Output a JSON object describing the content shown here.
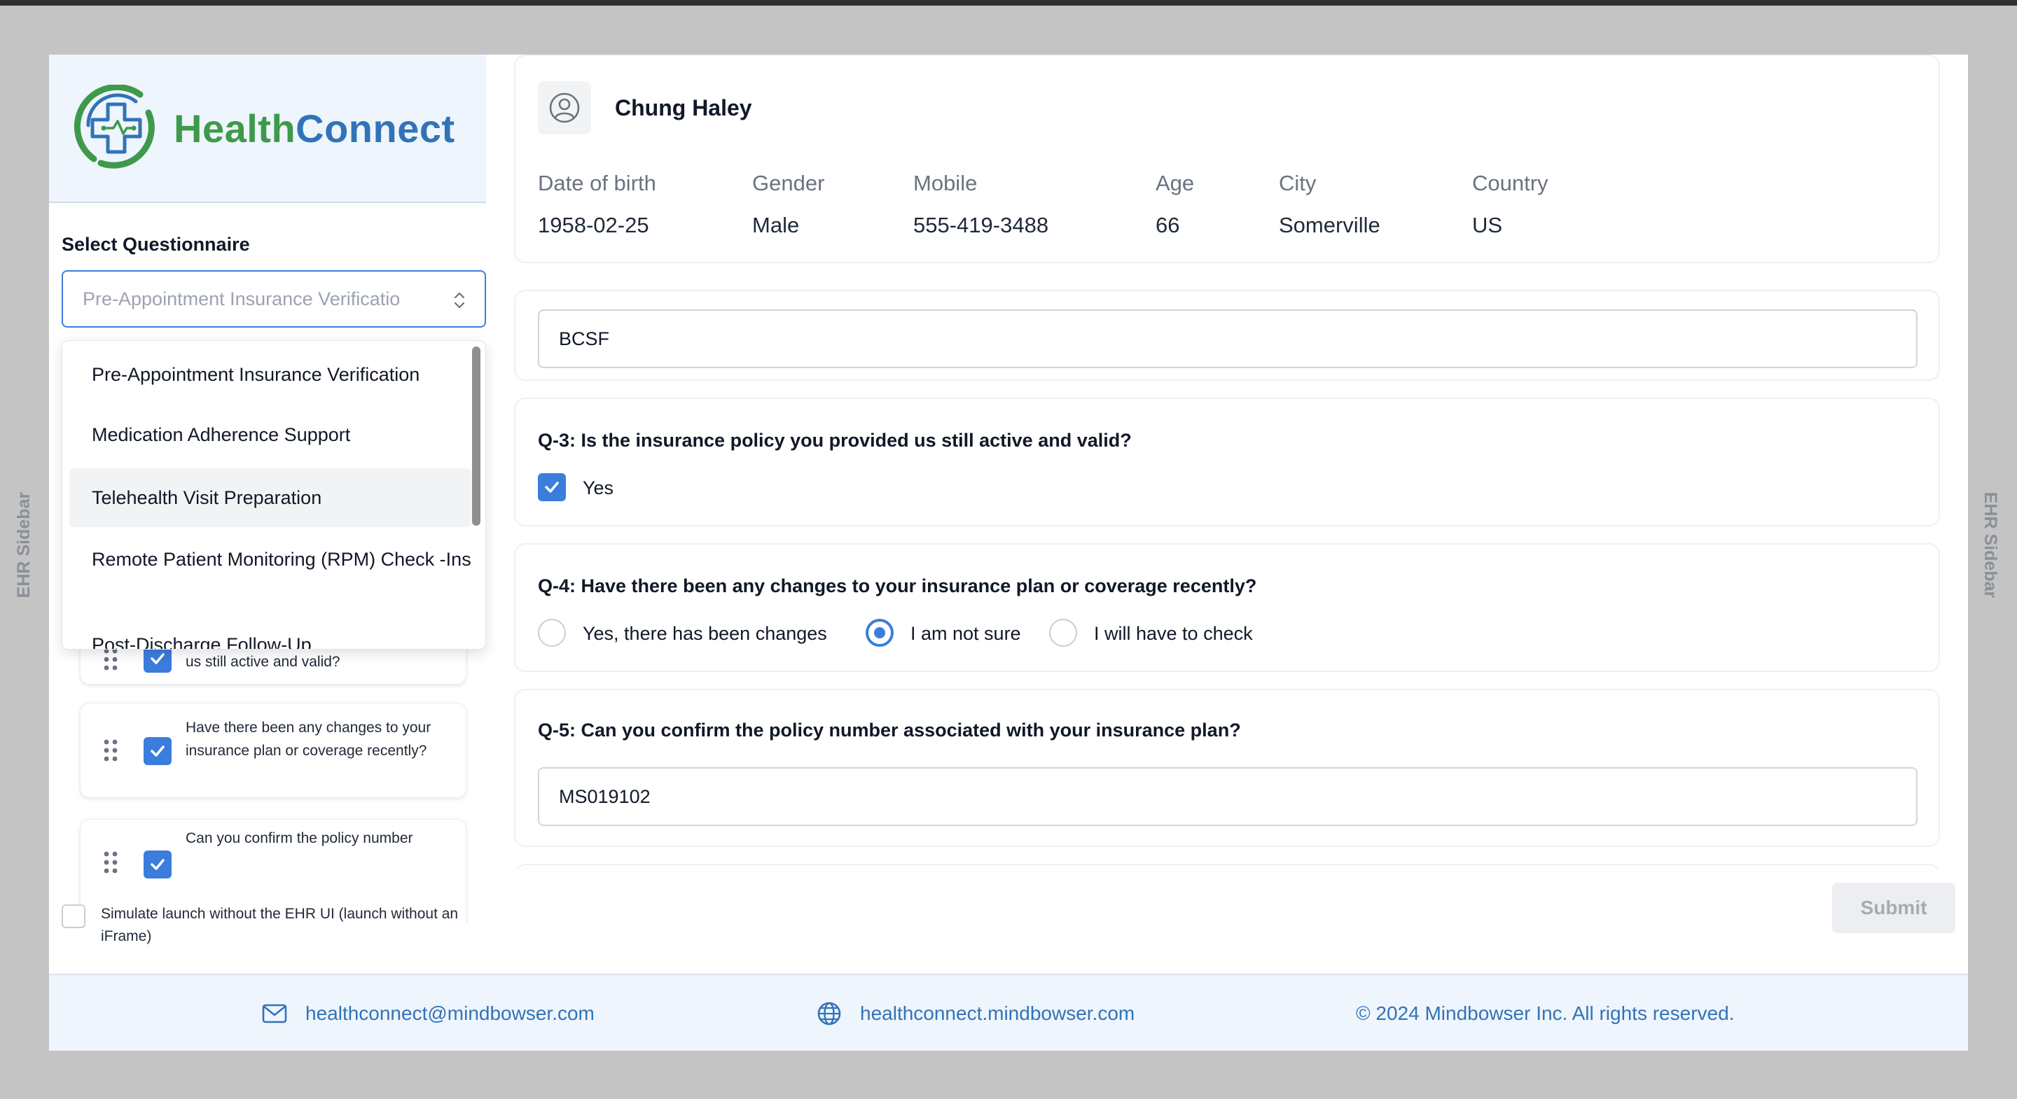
{
  "sidebar_tabs": {
    "left": "EHR Sidebar",
    "right": "EHR Sidebar"
  },
  "logo": {
    "health": "Health",
    "connect": "Connect"
  },
  "questionnaire": {
    "label": "Select Questionnaire",
    "placeholder": "Pre-Appointment Insurance Verificatio",
    "options": [
      "Pre-Appointment Insurance Verification",
      "Medication Adherence Support",
      "Telehealth Visit Preparation",
      "Remote Patient Monitoring (RPM) Check -Ins",
      "Post-Discharge Follow-Up"
    ],
    "highlighted_option": "Telehealth Visit Preparation"
  },
  "question_list": [
    {
      "text": "us still active and valid?",
      "checked": true
    },
    {
      "text": "Have there been any changes to your insurance plan or coverage recently?",
      "checked": true
    },
    {
      "text": "Can you confirm the policy number",
      "checked": true
    }
  ],
  "simulate": {
    "label": "Simulate launch without the EHR UI (launch without an iFrame)",
    "checked": false
  },
  "patient": {
    "name": "Chung Haley",
    "fields": [
      {
        "label": "Date of birth",
        "value": "1958-02-25"
      },
      {
        "label": "Gender",
        "value": "Male"
      },
      {
        "label": "Mobile",
        "value": "555-419-3488"
      },
      {
        "label": "Age",
        "value": "66"
      },
      {
        "label": "City",
        "value": "Somerville"
      },
      {
        "label": "Country",
        "value": "US"
      }
    ]
  },
  "form": {
    "prev_answer": "BCSF",
    "q3": {
      "title": "Q-3: Is the insurance policy you provided us still active and valid?",
      "option": "Yes",
      "checked": true
    },
    "q4": {
      "title": "Q-4: Have there been any changes to your insurance plan or coverage recently?",
      "options": [
        "Yes, there has been changes",
        "I am not sure",
        "I will have to check"
      ],
      "selected": "I am not sure"
    },
    "q5": {
      "title": "Q-5: Can you confirm the policy number associated with your insurance plan?",
      "answer": "MS019102"
    },
    "submit_label": "Submit"
  },
  "footer": {
    "email": "healthconnect@mindbowser.com",
    "website": "healthconnect.mindbowser.com",
    "copyright": "© 2024 Mindbowser Inc. All rights reserved."
  },
  "colors": {
    "accent": "#3b7ddd",
    "brand_green": "#3e9a4a",
    "brand_blue": "#3273b8"
  }
}
